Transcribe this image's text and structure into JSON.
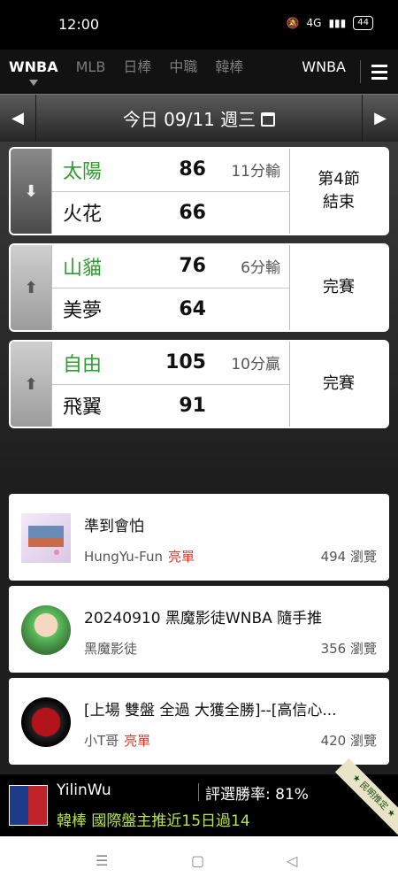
{
  "status_bar": {
    "time": "12:00",
    "signal": "4G",
    "battery": "44"
  },
  "tabs": [
    {
      "label": "WNBA",
      "active": true
    },
    {
      "label": "MLB",
      "active": false
    },
    {
      "label": "日棒",
      "active": false
    },
    {
      "label": "中職",
      "active": false
    },
    {
      "label": "韓棒",
      "active": false
    },
    {
      "label": "WNBA",
      "active": false
    }
  ],
  "date_bar": {
    "text": "今日 09/11 週三",
    "prev_icon": "◀",
    "next_icon": "▶"
  },
  "games": [
    {
      "expanded": true,
      "home": {
        "team": "太陽",
        "score": "86",
        "note": "11分輸",
        "winner": true
      },
      "away": {
        "team": "火花",
        "score": "66"
      },
      "status": "第4節\n結束"
    },
    {
      "expanded": false,
      "home": {
        "team": "山貓",
        "score": "76",
        "note": "6分輸",
        "winner": true
      },
      "away": {
        "team": "美夢",
        "score": "64"
      },
      "status": "完賽"
    },
    {
      "expanded": false,
      "home": {
        "team": "自由",
        "score": "105",
        "note": "10分贏",
        "winner": true
      },
      "away": {
        "team": "飛翼",
        "score": "91"
      },
      "status": "完賽"
    }
  ],
  "articles": [
    {
      "title": "準到會怕",
      "author": "HungYu-Fun",
      "tag": "亮單",
      "views": "494 瀏覽"
    },
    {
      "title": "20240910 黑魔影徒WNBA 隨手推",
      "author": "黑魔影徒",
      "tag": "",
      "views": "356 瀏覽"
    },
    {
      "title": "[上場 雙盤 全過 大獲全勝]--[高信心...",
      "author": "小T哥",
      "tag": "亮單",
      "views": "420 瀏覽"
    }
  ],
  "promo": {
    "user": "YilinWu",
    "win_rate": "評選勝率: 81%",
    "text": "韓棒 國際盤主推近15日過14",
    "ribbon": "★ 民明推定 ★"
  },
  "colors": {
    "winner_green": "#2e9f2e",
    "tag_red": "#e03b2a",
    "promo_green": "#b8e34a"
  }
}
